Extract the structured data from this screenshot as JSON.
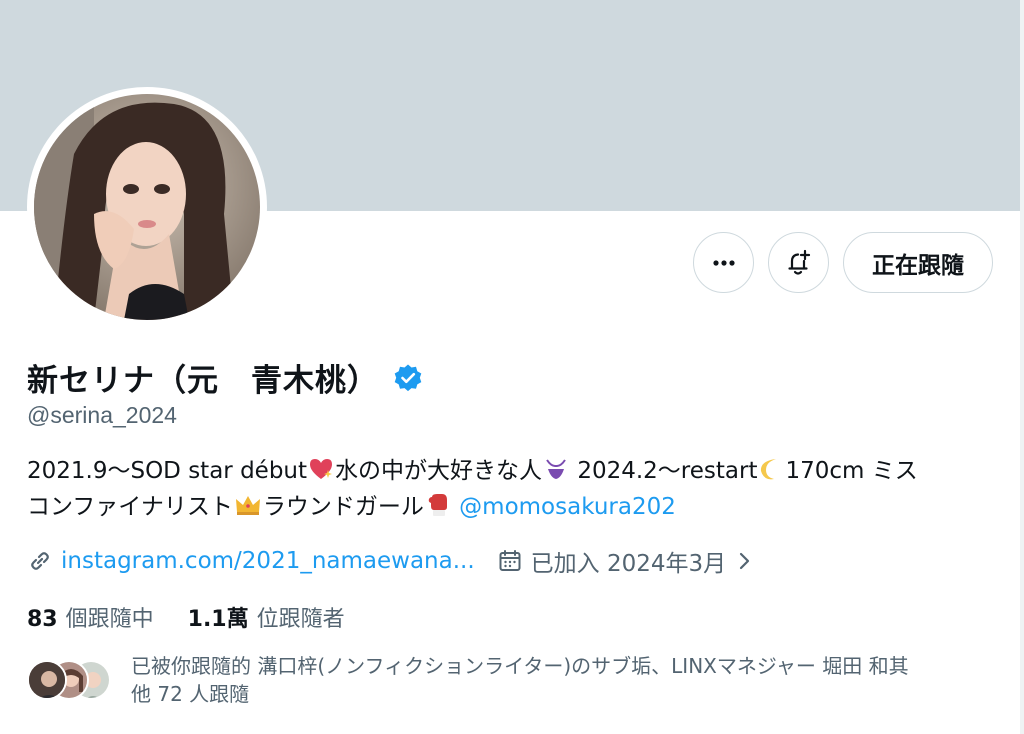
{
  "profile": {
    "display_name": "新セリナ（元　青木桃）",
    "handle": "@serina_2024",
    "verified_icon": "verified-badge-icon",
    "avatar_alt": "profile photo"
  },
  "actions": {
    "more_icon": "more-icon",
    "notify_icon": "bell-plus-icon",
    "follow_label": "正在跟隨"
  },
  "bio": {
    "line1_part1": "2021.9～SOD star début",
    "line1_part2": "水の中が大好きな人",
    "line1_part3": " 2024.2～restart",
    "line1_part4": "170cm ミス",
    "line2_part1": "コンファイナリスト",
    "line2_part2": "ラウンドガール",
    "mention": "@momosakura202"
  },
  "meta": {
    "link_icon": "link-icon",
    "link_text": "instagram.com/2021_namaewana...",
    "calendar_icon": "calendar-icon",
    "joined_text": "已加入 2024年3月",
    "chevron_icon": "chevron-right-icon"
  },
  "stats": {
    "following_count": "83",
    "following_label": "個跟隨中",
    "followers_count": "1.1萬",
    "followers_label": "位跟隨者"
  },
  "followers_you_know": {
    "text_line1": "已被你跟隨的 溝口梓(ノンフィクションライター)のサブ垢、LINXマネジャー 堀田 和其",
    "text_line2": "他 72 人跟隨"
  },
  "colors": {
    "banner": "#cfd9de",
    "accent": "#1d9bf0",
    "secondary_text": "#536471"
  }
}
